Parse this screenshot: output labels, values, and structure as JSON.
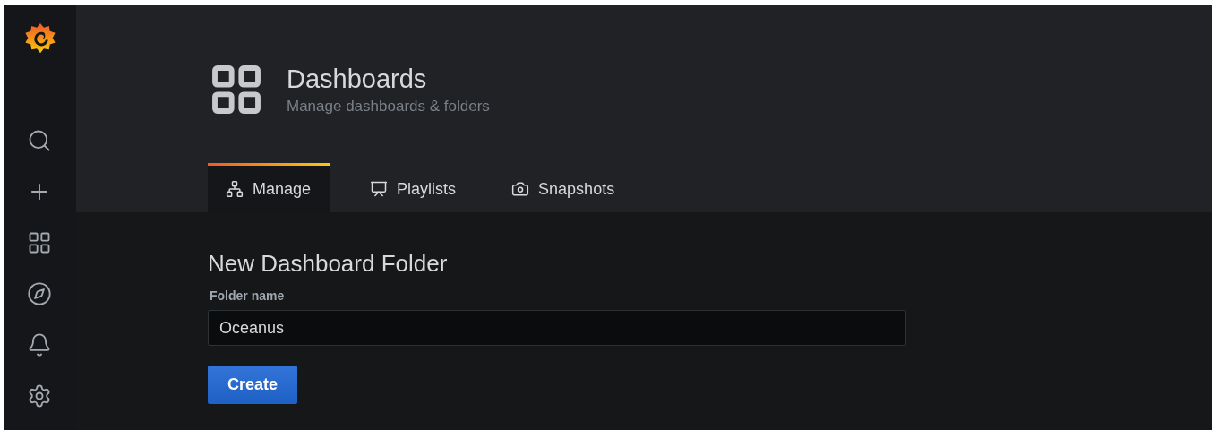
{
  "sidebar": {
    "items": [
      {
        "kind": "search"
      },
      {
        "kind": "create"
      },
      {
        "kind": "dashboards"
      },
      {
        "kind": "explore"
      },
      {
        "kind": "alerting"
      },
      {
        "kind": "configuration"
      }
    ]
  },
  "header": {
    "title": "Dashboards",
    "subtitle": "Manage dashboards & folders"
  },
  "tabs": [
    {
      "label": "Manage",
      "kind": "manage",
      "selected": true
    },
    {
      "label": "Playlists",
      "kind": "playlists",
      "selected": false
    },
    {
      "label": "Snapshots",
      "kind": "snapshots",
      "selected": false
    }
  ],
  "form": {
    "heading": "New Dashboard Folder",
    "field_label": "Folder name",
    "value": "Oceanus",
    "button": "Create"
  }
}
